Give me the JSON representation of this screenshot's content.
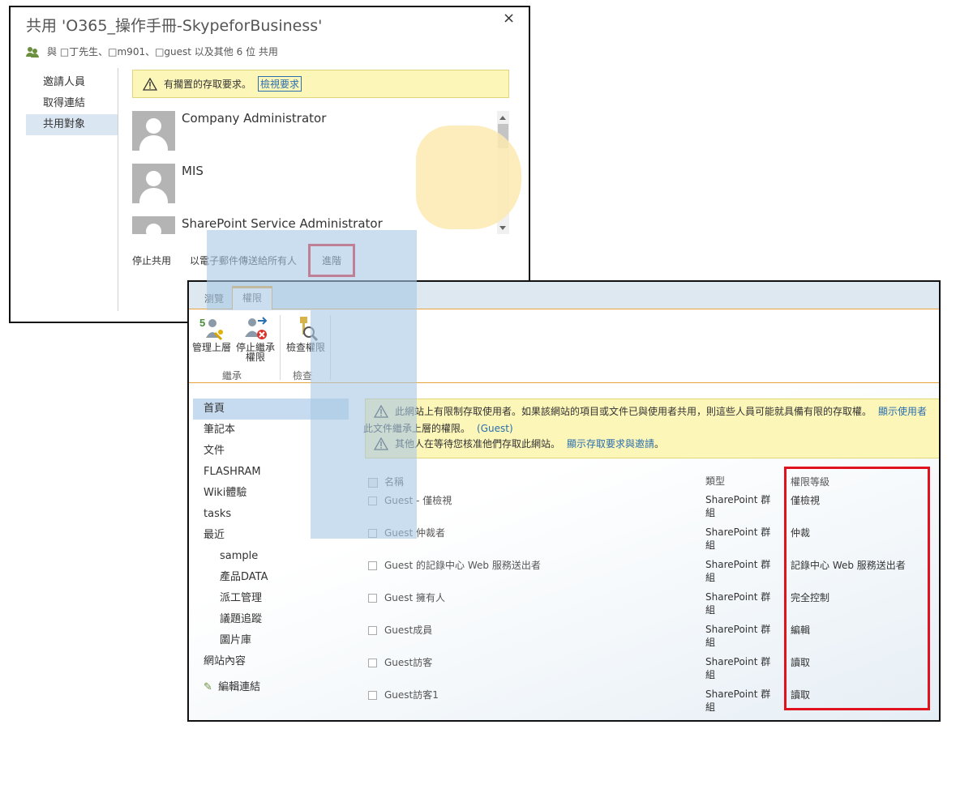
{
  "share_dialog": {
    "title": "共用 'O365_操作手冊-SkypeforBusiness'",
    "close_label": "×",
    "shared_with": "與 □丁先生、□m901、□guest 以及其他 6 位 共用",
    "nav": [
      {
        "label": "邀請人員",
        "active": false
      },
      {
        "label": "取得連結",
        "active": false
      },
      {
        "label": "共用對象",
        "active": true
      }
    ],
    "banner_text": "有擱置的存取要求。",
    "banner_link": "檢視要求",
    "people": [
      {
        "name": "Company Administrator"
      },
      {
        "name": "MIS"
      },
      {
        "name": "SharePoint Service Administrator"
      }
    ],
    "actions": {
      "stop_sharing": "停止共用",
      "email_all": "以電子郵件傳送給所有人",
      "advanced": "進階"
    }
  },
  "permissions_page": {
    "tabs": [
      {
        "label": "瀏覽",
        "active": false
      },
      {
        "label": "權限",
        "active": true
      }
    ],
    "ribbon": {
      "manage_parent": "管理上層",
      "stop_inherit_1": "停止繼承",
      "stop_inherit_2": "權限",
      "check_permissions": "檢查權限",
      "group_inherit": "繼承",
      "group_check": "檢查"
    },
    "left_nav": [
      {
        "label": "首頁",
        "level": 0,
        "active": true
      },
      {
        "label": "筆記本",
        "level": 0
      },
      {
        "label": "文件",
        "level": 0
      },
      {
        "label": "FLASHRAM",
        "level": 0
      },
      {
        "label": "Wiki體驗",
        "level": 0
      },
      {
        "label": "tasks",
        "level": 0
      },
      {
        "label": "最近",
        "level": 0
      },
      {
        "label": "sample",
        "level": 1
      },
      {
        "label": "產品DATA",
        "level": 1
      },
      {
        "label": "派工管理",
        "level": 1
      },
      {
        "label": "議題追蹤",
        "level": 1
      },
      {
        "label": "圖片庫",
        "level": 1
      },
      {
        "label": "網站內容",
        "level": 0
      }
    ],
    "edit_links": "編輯連結",
    "status": {
      "line1": "此網站上有限制存取使用者。如果該網站的項目或文件已與使用者共用，則這些人員可能就具備有限的存取權。",
      "line1_link": "顯示使用者",
      "line2": "此文件繼承上層的權限。",
      "line2_guest": "(Guest)",
      "line3": "其他人在等待您核准他們存取此網站。",
      "line3_link": "顯示存取要求與邀請",
      "line3_end": "。"
    },
    "table": {
      "headers": {
        "name": "名稱",
        "type": "類型",
        "level": "權限等級"
      },
      "rows": [
        {
          "name": "Guest - 僅檢視",
          "type": "SharePoint 群組",
          "level": "僅檢視"
        },
        {
          "name": "Guest 仲裁者",
          "type": "SharePoint 群組",
          "level": "仲裁"
        },
        {
          "name": "Guest 的記錄中心 Web 服務送出者",
          "type": "SharePoint 群組",
          "level": "記錄中心 Web 服務送出者"
        },
        {
          "name": "Guest 擁有人",
          "type": "SharePoint 群組",
          "level": "完全控制"
        },
        {
          "name": "Guest成員",
          "type": "SharePoint 群組",
          "level": "編輯"
        },
        {
          "name": "Guest訪客",
          "type": "SharePoint 群組",
          "level": "讀取"
        },
        {
          "name": "Guest訪客1",
          "type": "SharePoint 群組",
          "level": "讀取"
        }
      ]
    }
  },
  "colors": {
    "highlight_box": "#e0121e",
    "ribbon_accent": "#e8a33d",
    "link": "#2a6ead",
    "banner_bg": "#fdf6b9"
  }
}
